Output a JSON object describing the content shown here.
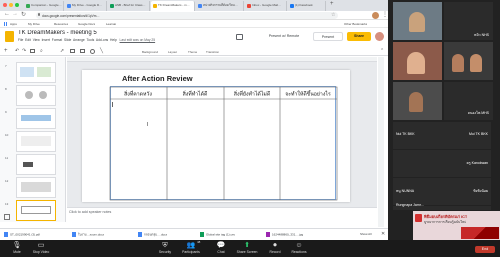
{
  "browser": {
    "tabs": [
      "Companion - Google…",
      "My Drive - Google D…",
      "ASB - Brief for Class…",
      "TK DreamMakers - m…",
      "หน่วยกิจกรรมที่ต้องเรียน…",
      "Inbox - Google Mail…",
      "(1) Facebook"
    ],
    "url": "docs.google.com/presentation/d/1pVm…",
    "bookmarks": [
      "Apps",
      "My Drive",
      "Resources",
      "Google Docs",
      "Learnai"
    ],
    "other_bookmarks": "Other Bookmarks"
  },
  "slides": {
    "doc_title": "TK DreamMakers - meeting 5",
    "menu": [
      "File",
      "Edit",
      "View",
      "Insert",
      "Format",
      "Slide",
      "Arrange",
      "Tools",
      "Add-ons",
      "Help"
    ],
    "last_edit": "Last edit was on May 25",
    "present_remote": "Present w/ Remote",
    "present": "Present",
    "share": "Share",
    "toolbar": [
      "Background",
      "Layout",
      "Theme",
      "Transition"
    ],
    "slide_numbers": [
      "7",
      "8",
      "9",
      "10",
      "11",
      "12",
      "13"
    ],
    "slide_title": "After Action Review",
    "table_headers": [
      "สิ่งที่คาดหวัง",
      "สิ่งที่ทำได้ดี",
      "สิ่งที่ยังทำได้ไม่ดี",
      "จะทำให้ดีขึ้นอย่างไร"
    ],
    "notes_placeholder": "Click to add speaker notes"
  },
  "downloads": [
    "ST_002199041 (3).pdf",
    "ใบงาน…zoom.docx",
    "กลอนกลุ่ม….docx",
    "Global site tag (1).csv",
    "1624488860_331….jpg"
  ],
  "show_all": "Show All",
  "zoom": {
    "controls": [
      "Mute",
      "Stop Video",
      "Security",
      "Participants",
      "Chat",
      "Share Screen",
      "Record",
      "Reactions"
    ],
    "participant_count": "48",
    "end": "End",
    "participants": [
      "หมิว NHS",
      "Nui TK BKK",
      "หนองโพ.MHS",
      "Mui TK BKK",
      "ครู Kanokwan",
      "หนู NUNNA",
      "ขิงขิงน้อย",
      "Rungnapa Jamr…"
    ],
    "banner_lines": [
      "พิธีมอบเกียรติบัตรแก่ ICT",
      "บูรณาการการเรียนรู้ฉบับใหม่"
    ]
  },
  "colors": {
    "accent": "#f4b400",
    "share": "#fbbc04",
    "table_border": "#666666"
  }
}
